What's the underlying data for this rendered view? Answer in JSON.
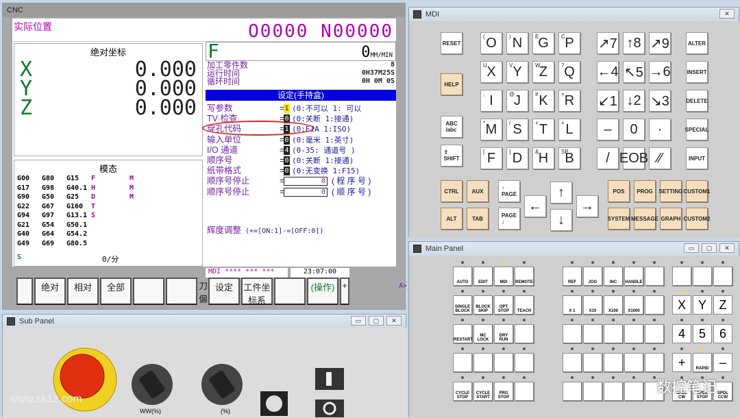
{
  "cnc": {
    "title": "CNC",
    "pos_label": "实际位置",
    "prog": "O0000 N00000",
    "abs_title": "绝对坐标",
    "axes": [
      {
        "n": "X",
        "v": "0.000"
      },
      {
        "n": "Y",
        "v": "0.000"
      },
      {
        "n": "Z",
        "v": "0.000"
      }
    ],
    "modal_title": "模态",
    "gcodes": [
      [
        "G00",
        "G80",
        "G15",
        "F",
        "M"
      ],
      [
        "G17",
        "G98",
        "G40.1",
        "H",
        "M"
      ],
      [
        "G90",
        "G50",
        "G25",
        "D",
        "M"
      ],
      [
        "G22",
        "G67",
        "G160",
        "T",
        ""
      ],
      [
        "G94",
        "G97",
        "G13.1",
        "S",
        ""
      ],
      [
        "G21",
        "G54",
        "G50.1",
        "",
        ""
      ],
      [
        "G40",
        "G64",
        "G54.2",
        "",
        ""
      ],
      [
        "G49",
        "G69",
        "G80.5",
        "",
        ""
      ]
    ],
    "s_label": "S",
    "feed": "0/分",
    "f_label": "F",
    "f_val": "0",
    "f_unit": "MM/MIN",
    "info": [
      {
        "l": "加工零件数",
        "v": "8"
      },
      {
        "l": "运行时间",
        "v": "0H37M25S"
      },
      {
        "l": "循环时间",
        "v": "0H 0M 0S"
      }
    ],
    "setting_title": "设定(手持盒)",
    "params": [
      {
        "l": "写参数",
        "v": "1",
        "d": "(0:不可以   1: 可以",
        "hl": true
      },
      {
        "l": "TV  检查",
        "v": "0",
        "d": "(0:关断    1:接通)"
      },
      {
        "l": "穿孔代码",
        "v": "1",
        "d": "(0:EIA    1:ISO)"
      },
      {
        "l": "输入单位",
        "v": "0",
        "d": "(0:毫米     1:英寸)"
      },
      {
        "l": "I/O  通道",
        "v": "4",
        "d": "(0-35: 通道号     )"
      },
      {
        "l": "顺序号",
        "v": "0",
        "d": "(0:关断    1:接通)"
      },
      {
        "l": "纸带格式",
        "v": "0",
        "d": "(0:无变换  1:F15)"
      }
    ],
    "seq": [
      {
        "l": "顺序号停止",
        "v": "0",
        "d": "( 程 序 号 )"
      },
      {
        "l": "顺序号停止",
        "v": "0",
        "d": "( 顺 序 号 )"
      }
    ],
    "bright": "辉度调整",
    "bright_d": "(+=[ON:1]-=[OFF:0])",
    "cmd": "A>_",
    "mode": "MDI  **** *** ***",
    "time": "23:07:00",
    "softkeys": [
      "绝对",
      "相对",
      "全部",
      "",
      "",
      "刀偏",
      "设定",
      "工件坐标系",
      "",
      "(操作)",
      "+"
    ]
  },
  "mdi": {
    "title": "MDI"
  },
  "sub": {
    "title": "Sub Panel",
    "ov1": "WW(%)",
    "ov2": "(%)"
  },
  "main": {
    "title": "Main Panel"
  },
  "watermark": "www.sk1z.com",
  "logo": "数控笔记"
}
